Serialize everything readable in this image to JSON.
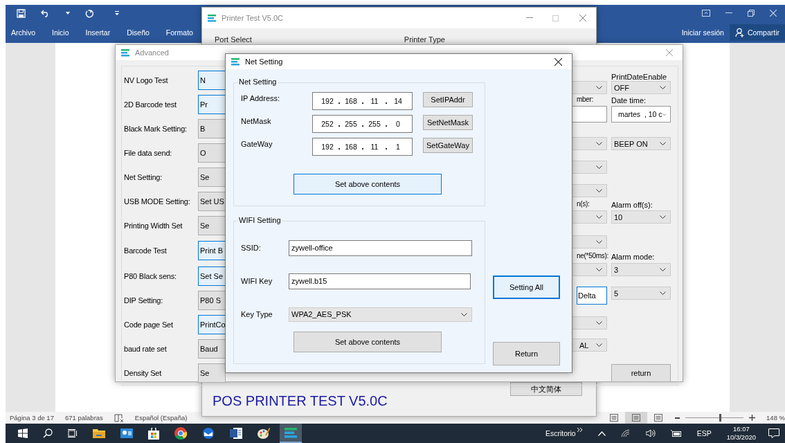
{
  "word": {
    "tabs": [
      "Archivo",
      "Inicio",
      "Insertar",
      "Diseño",
      "Formato"
    ],
    "account": "Iniciar sesión",
    "share": "Compartir",
    "status_bar": {
      "page": "Página 3 de 17",
      "words": "671 palabras",
      "language": "Español (España)",
      "zoom": "148 %",
      "zoom_slider": {
        "level": 0.6
      },
      "view_modes": [
        {
          "selected": false
        },
        {
          "selected": true
        },
        {
          "selected": false
        }
      ]
    }
  },
  "printer_test": {
    "title": "Printer Test V5.0C",
    "port_select": "Port Select",
    "printer_type": "Printer Type",
    "banner": "POS PRINTER TEST V5.0C",
    "language_button": "中文简体"
  },
  "advanced": {
    "title": "Advanced",
    "rows": [
      {
        "label": "NV Logo Test",
        "button": "N",
        "highlighted": true
      },
      {
        "label": "2D Barcode test",
        "button": "Pr",
        "highlighted": true
      },
      {
        "label": "Black Mark Setting:",
        "button": "B",
        "highlighted": false
      },
      {
        "label": "File data send:",
        "button": "O",
        "highlighted": false
      },
      {
        "label": "Net Setting:",
        "button": "Se",
        "highlighted": false
      },
      {
        "label": "USB MODE Setting:",
        "button": "Set US",
        "highlighted": false
      },
      {
        "label": "Printing Width Set",
        "button": "Se",
        "highlighted": false
      },
      {
        "label": "Barcode Test",
        "button": "Print B",
        "highlighted": true
      },
      {
        "label": "P80 Black sens:",
        "button": "Set Se",
        "highlighted": true
      },
      {
        "label": "DIP Setting:",
        "button": "P80 S",
        "highlighted": false
      },
      {
        "label": "Code page Set",
        "button": "PrintCo",
        "highlighted": true
      },
      {
        "label": "baud rate set",
        "button": "Baud",
        "highlighted": false
      },
      {
        "label": "Density Set",
        "button": "Se",
        "highlighted": false
      }
    ],
    "right_rows": [
      {
        "b": {
          "kind": "label",
          "text": "PrintDateEnable"
        }
      },
      {
        "a": {
          "kind": "dropdown"
        },
        "b": {
          "kind": "dropdown",
          "text": "OFF"
        }
      },
      {
        "a": {
          "kind": "label",
          "text": "mber:"
        },
        "b": {
          "kind": "label",
          "text": "Date time:"
        }
      },
      {
        "a": {
          "kind": "textbox"
        },
        "b": {
          "kind": "datepicker",
          "text": "martes  , 10 c"
        }
      },
      {
        "a": {
          "kind": "dropdown"
        },
        "b": {
          "kind": "dropdown",
          "text": "BEEP ON"
        }
      },
      {
        "a": {
          "kind": "dropdown"
        }
      },
      {
        "a": {
          "kind": "dropdown"
        }
      },
      {
        "a": {
          "kind": "label",
          "text": "n(s):"
        },
        "b": {
          "kind": "label",
          "text": "Alarm off(s):"
        }
      },
      {
        "a": {
          "kind": "dropdown"
        },
        "b": {
          "kind": "dropdown",
          "text": "10"
        }
      },
      {
        "a": {
          "kind": "dropdown"
        }
      },
      {
        "a": {
          "kind": "label",
          "text": "ne(*50ms):"
        },
        "b": {
          "kind": "label",
          "text": "Alarm mode:"
        }
      },
      {
        "a": {
          "kind": "dropdown"
        },
        "b": {
          "kind": "dropdown",
          "text": "3"
        }
      },
      {
        "a": {
          "kind": "button",
          "text": "Delta"
        },
        "b": {
          "kind": "dropdown",
          "text": "5"
        }
      },
      {
        "a": {
          "kind": "dropdown"
        }
      },
      {
        "a": {
          "kind": "dropdown",
          "text": "AL"
        }
      },
      {
        "b": {
          "kind": "button",
          "text": "return"
        }
      }
    ]
  },
  "net_setting": {
    "title": "Net Setting",
    "net_group": "Net Setting",
    "fields": [
      {
        "label": "IP Address:",
        "octets": [
          "192",
          "168",
          "11",
          "14"
        ],
        "button": "SetIPAddr"
      },
      {
        "label": "NetMask",
        "octets": [
          "252",
          "255",
          "255",
          "0"
        ],
        "button": "SetNetMask"
      },
      {
        "label": "GateWay",
        "octets": [
          "192",
          "168",
          "11",
          "1"
        ],
        "button": "SetGateWay"
      }
    ],
    "net_apply": "Set above contents",
    "wifi_group": "WIFI Setting",
    "ssid": {
      "label": "SSID:",
      "value": "zywell-office"
    },
    "wifi_key": {
      "label": "WIFI Key",
      "value": "zywell.b15"
    },
    "key_type": {
      "label": "Key Type",
      "value": "WPA2_AES_PSK"
    },
    "wifi_apply": "Set above contents",
    "setting_all": "Setting All",
    "return": "Return"
  },
  "taskbar": {
    "desktop": "Escritorio",
    "language": "ESP",
    "time": "16:07",
    "date": "10/3/2020"
  }
}
